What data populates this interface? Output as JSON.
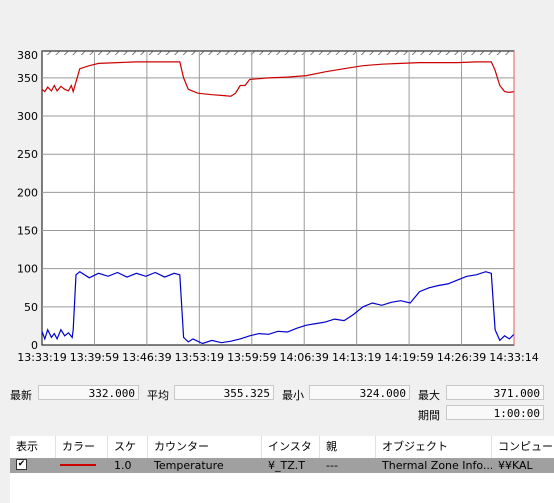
{
  "chart_data": {
    "type": "line",
    "title": "",
    "xlabel": "",
    "ylabel": "",
    "ylim": [
      0,
      380
    ],
    "yticks": [
      0,
      50,
      100,
      150,
      200,
      250,
      300,
      350,
      380
    ],
    "xticks": [
      "13:33:19",
      "13:39:59",
      "13:46:39",
      "13:53:19",
      "13:59:59",
      "14:06:39",
      "14:13:19",
      "14:19:59",
      "14:26:39",
      "14:33:14"
    ],
    "grid": true,
    "series": [
      {
        "name": "",
        "color": "#cc0000",
        "points": [
          [
            0,
            335
          ],
          [
            0.3,
            332
          ],
          [
            0.6,
            338
          ],
          [
            1.0,
            333
          ],
          [
            1.3,
            340
          ],
          [
            1.6,
            333
          ],
          [
            2.0,
            339
          ],
          [
            2.4,
            335
          ],
          [
            2.8,
            333
          ],
          [
            3.1,
            340
          ],
          [
            3.3,
            332
          ],
          [
            4.0,
            362
          ],
          [
            5.0,
            366
          ],
          [
            6.0,
            369
          ],
          [
            8.0,
            370
          ],
          [
            10.0,
            371
          ],
          [
            13.0,
            371
          ],
          [
            14.6,
            371
          ],
          [
            15.0,
            350
          ],
          [
            15.5,
            335
          ],
          [
            16.5,
            330
          ],
          [
            18.0,
            328
          ],
          [
            19.0,
            327
          ],
          [
            20.0,
            326
          ],
          [
            20.5,
            330
          ],
          [
            21.0,
            340
          ],
          [
            21.5,
            340
          ],
          [
            22.0,
            348
          ],
          [
            24.0,
            350
          ],
          [
            26.0,
            351
          ],
          [
            28.0,
            353
          ],
          [
            30.0,
            358
          ],
          [
            32.0,
            362
          ],
          [
            34.0,
            366
          ],
          [
            36.0,
            368
          ],
          [
            38.0,
            369
          ],
          [
            40.0,
            370
          ],
          [
            42.0,
            370
          ],
          [
            44.0,
            370
          ],
          [
            46.0,
            371
          ],
          [
            47.6,
            371
          ],
          [
            48.0,
            360
          ],
          [
            48.5,
            340
          ],
          [
            49.0,
            332
          ],
          [
            49.5,
            331
          ],
          [
            50.0,
            332
          ]
        ]
      },
      {
        "name": "",
        "color": "#0000cc",
        "points": [
          [
            0,
            18
          ],
          [
            0.3,
            8
          ],
          [
            0.6,
            20
          ],
          [
            1.0,
            10
          ],
          [
            1.3,
            15
          ],
          [
            1.6,
            8
          ],
          [
            2.0,
            20
          ],
          [
            2.4,
            12
          ],
          [
            2.8,
            16
          ],
          [
            3.2,
            10
          ],
          [
            3.3,
            20
          ],
          [
            3.6,
            92
          ],
          [
            4.0,
            96
          ],
          [
            5.0,
            88
          ],
          [
            6.0,
            94
          ],
          [
            7.0,
            90
          ],
          [
            8.0,
            95
          ],
          [
            9.0,
            89
          ],
          [
            10.0,
            94
          ],
          [
            11.0,
            90
          ],
          [
            12.0,
            95
          ],
          [
            13.0,
            89
          ],
          [
            14.0,
            94
          ],
          [
            14.6,
            92
          ],
          [
            15.0,
            10
          ],
          [
            15.5,
            4
          ],
          [
            16.0,
            8
          ],
          [
            17.0,
            2
          ],
          [
            18.0,
            6
          ],
          [
            19.0,
            3
          ],
          [
            20.0,
            5
          ],
          [
            21.0,
            8
          ],
          [
            22.0,
            12
          ],
          [
            23.0,
            15
          ],
          [
            24.0,
            14
          ],
          [
            25.0,
            18
          ],
          [
            26.0,
            17
          ],
          [
            27.0,
            22
          ],
          [
            28.0,
            26
          ],
          [
            29.0,
            28
          ],
          [
            30.0,
            30
          ],
          [
            31.0,
            34
          ],
          [
            32.0,
            32
          ],
          [
            33.0,
            40
          ],
          [
            34.0,
            50
          ],
          [
            35.0,
            55
          ],
          [
            36.0,
            52
          ],
          [
            37.0,
            56
          ],
          [
            38.0,
            58
          ],
          [
            39.0,
            55
          ],
          [
            40.0,
            70
          ],
          [
            41.0,
            75
          ],
          [
            42.0,
            78
          ],
          [
            43.0,
            80
          ],
          [
            44.0,
            85
          ],
          [
            45.0,
            90
          ],
          [
            46.0,
            92
          ],
          [
            47.0,
            96
          ],
          [
            47.6,
            94
          ],
          [
            48.0,
            20
          ],
          [
            48.5,
            6
          ],
          [
            49.0,
            12
          ],
          [
            49.5,
            8
          ],
          [
            50.0,
            14
          ]
        ]
      }
    ]
  },
  "stats": {
    "latest_label": "最新",
    "latest_value": "332.000",
    "average_label": "平均",
    "average_value": "355.325",
    "min_label": "最小",
    "min_value": "324.000",
    "max_label": "最大",
    "max_value": "371.000",
    "duration_label": "期間",
    "duration_value": "1:00:00"
  },
  "table": {
    "headers": [
      "表示",
      "カラー",
      "スケ",
      "カウンター",
      "インスタ",
      "親",
      "オブジェクト",
      "コンピュータ"
    ],
    "row": {
      "scale": "1.0",
      "counter": "Temperature",
      "instance": "¥_TZ.T",
      "parent": "---",
      "object": "Thermal Zone Info...",
      "computer": "¥¥KAL"
    }
  }
}
